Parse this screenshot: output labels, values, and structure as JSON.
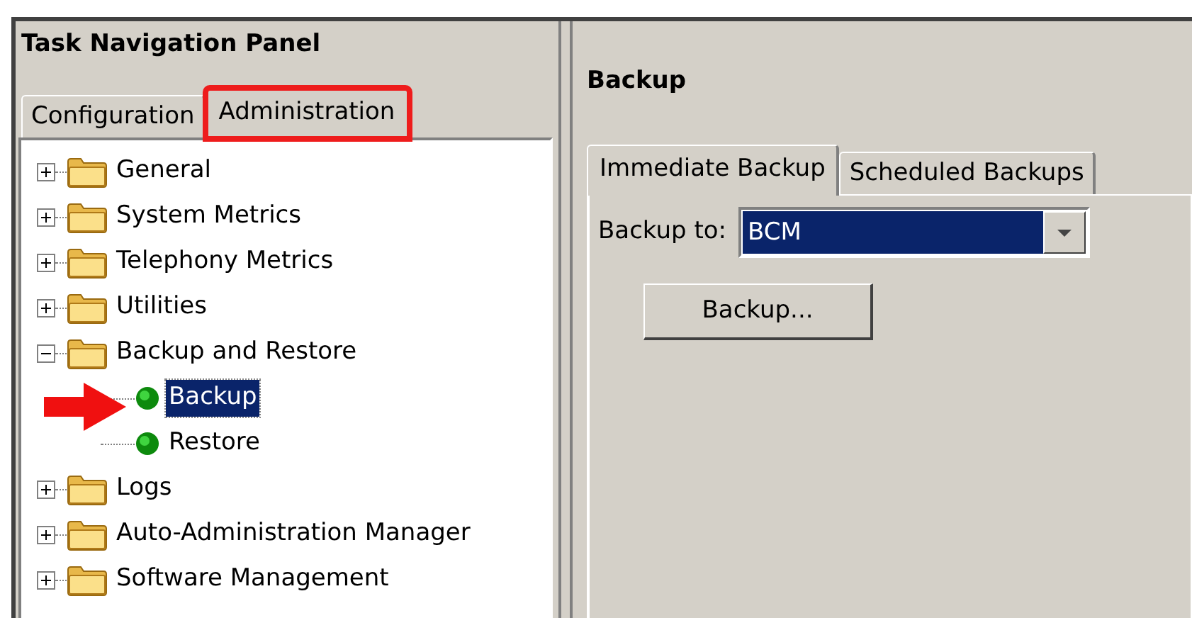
{
  "navigation_panel": {
    "title": "Task Navigation Panel",
    "tabs": [
      {
        "label": "Configuration",
        "selected": false,
        "highlighted": false
      },
      {
        "label": "Administration",
        "selected": true,
        "highlighted": true
      }
    ],
    "tree": [
      {
        "label": "General",
        "kind": "folder",
        "expanded": false,
        "selected": false
      },
      {
        "label": "System Metrics",
        "kind": "folder",
        "expanded": false,
        "selected": false
      },
      {
        "label": "Telephony Metrics",
        "kind": "folder",
        "expanded": false,
        "selected": false
      },
      {
        "label": "Utilities",
        "kind": "folder",
        "expanded": false,
        "selected": false
      },
      {
        "label": "Backup and Restore",
        "kind": "folder",
        "expanded": true,
        "selected": false,
        "children": [
          {
            "label": "Backup",
            "kind": "task",
            "selected": true,
            "pointed": true
          },
          {
            "label": "Restore",
            "kind": "task",
            "selected": false,
            "pointed": false
          }
        ]
      },
      {
        "label": "Logs",
        "kind": "folder",
        "expanded": false,
        "selected": false
      },
      {
        "label": "Auto-Administration Manager",
        "kind": "folder",
        "expanded": false,
        "selected": false
      },
      {
        "label": "Software Management",
        "kind": "folder",
        "expanded": false,
        "selected": false
      }
    ]
  },
  "content_panel": {
    "title": "Backup",
    "tabs": [
      {
        "label": "Immediate Backup",
        "selected": true
      },
      {
        "label": "Scheduled Backups",
        "selected": false
      }
    ],
    "backup_to": {
      "label": "Backup to:",
      "value": "BCM"
    },
    "buttons": [
      "Backup..."
    ]
  }
}
